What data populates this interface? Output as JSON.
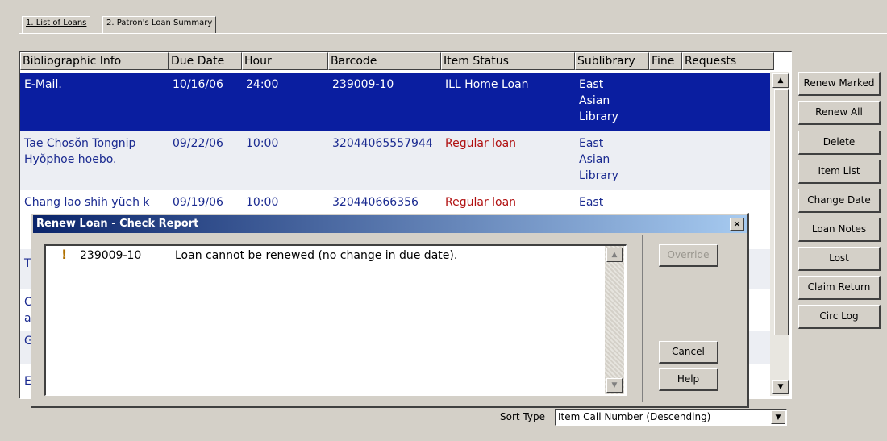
{
  "tabs": [
    {
      "label": "1. List of Loans"
    },
    {
      "label": "2. Patron's Loan Summary"
    }
  ],
  "table": {
    "columns": [
      "Bibliographic Info",
      "Due Date",
      "Hour",
      "Barcode",
      "Item Status",
      "Sublibrary",
      "Fine",
      "Requests"
    ],
    "rows": [
      {
        "bib": "E-Mail.",
        "due": "10/16/06",
        "hour": "24:00",
        "barcode": "239009-10",
        "status": "ILL Home Loan",
        "sublibrary": "East Asian Library",
        "fine": "",
        "requests": ""
      },
      {
        "bib": "Tae Chosŏn Tongnip Hyŏphoe hoebo.",
        "due": "09/22/06",
        "hour": "10:00",
        "barcode": "32044065557944",
        "status": "Regular loan",
        "sublibrary": "East Asian Library",
        "fine": "",
        "requests": ""
      },
      {
        "bib": "Chang lao shih yüeh k",
        "due": "09/19/06",
        "hour": "10:00",
        "barcode": "320440666356",
        "status": "Regular loan",
        "sublibrary": "East",
        "fine": "",
        "requests": ""
      },
      {
        "bib": "T"
      },
      {
        "bib": "C a"
      },
      {
        "bib": "G"
      },
      {
        "bib": "E"
      }
    ]
  },
  "side_buttons": [
    "Renew Marked",
    "Renew All",
    "Delete",
    "Item List",
    "Change Date",
    "Loan Notes",
    "Lost",
    "Claim Return",
    "Circ Log"
  ],
  "sort": {
    "label": "Sort Type",
    "value": "Item Call Number (Descending)"
  },
  "dialog": {
    "title": "Renew Loan - Check Report",
    "close": "×",
    "message": {
      "icon": "!",
      "barcode": "239009-10",
      "text": "Loan cannot be renewed (no change in due date)."
    },
    "buttons": {
      "override": "Override",
      "cancel": "Cancel",
      "help": "Help"
    }
  },
  "colors": {
    "selection": "#0a1ea0",
    "status_red": "#b01010",
    "title_gradient_start": "#0a246a"
  }
}
